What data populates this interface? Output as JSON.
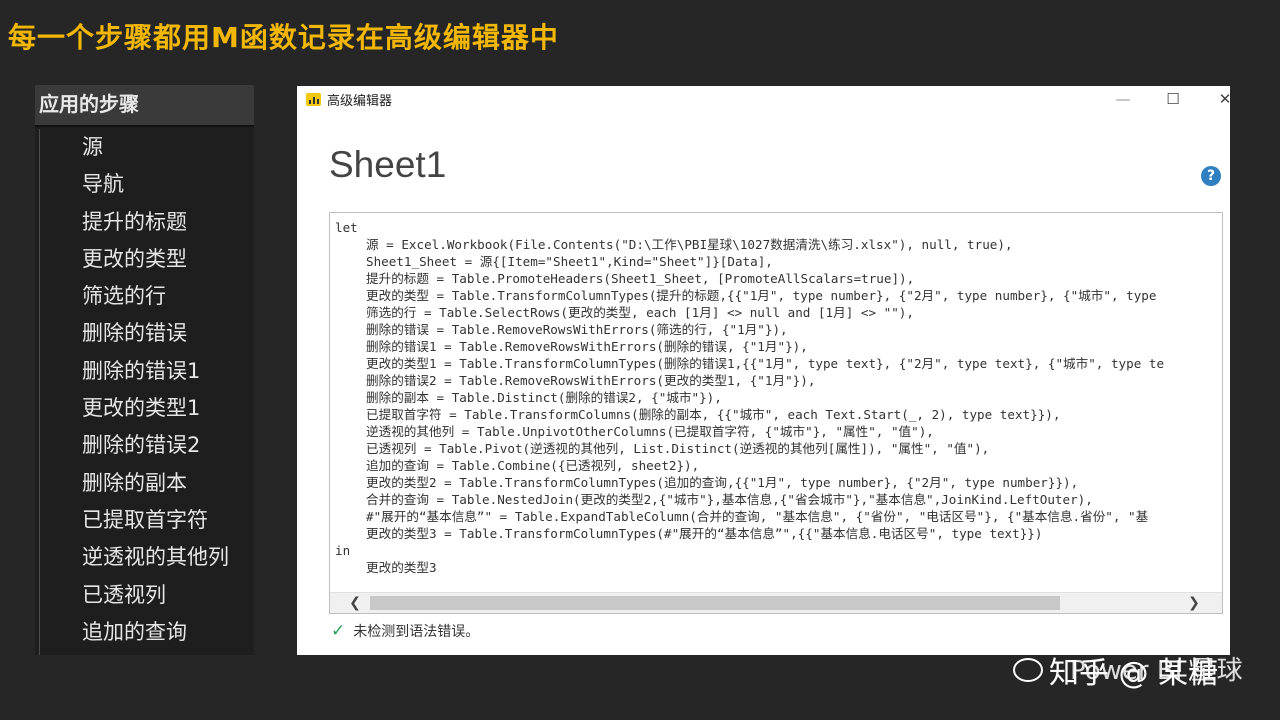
{
  "slide": {
    "title": "每一个步骤都用M函数记录在高级编辑器中"
  },
  "applied_steps": {
    "header": "应用的步骤",
    "items": [
      "源",
      "导航",
      "提升的标题",
      "更改的类型",
      "筛选的行",
      "删除的错误",
      "删除的错误1",
      "更改的类型1",
      "删除的错误2",
      "删除的副本",
      "已提取首字符",
      "逆透视的其他列",
      "已透视列",
      "追加的查询"
    ]
  },
  "editor": {
    "window_title": "高级编辑器",
    "query_name": "Sheet1",
    "help_glyph": "?",
    "window_controls": {
      "minimize": "—",
      "maximize": "☐",
      "close": "✕"
    },
    "code_lines": [
      "let",
      "源 = Excel.Workbook(File.Contents(\"D:\\工作\\PBI星球\\1027数据清洗\\练习.xlsx\"), null, true),",
      "Sheet1_Sheet = 源{[Item=\"Sheet1\",Kind=\"Sheet\"]}[Data],",
      "提升的标题 = Table.PromoteHeaders(Sheet1_Sheet, [PromoteAllScalars=true]),",
      "更改的类型 = Table.TransformColumnTypes(提升的标题,{{\"1月\", type number}, {\"2月\", type number}, {\"城市\", type",
      "筛选的行 = Table.SelectRows(更改的类型, each [1月] <> null and [1月] <> \"\"),",
      "删除的错误 = Table.RemoveRowsWithErrors(筛选的行, {\"1月\"}),",
      "删除的错误1 = Table.RemoveRowsWithErrors(删除的错误, {\"1月\"}),",
      "更改的类型1 = Table.TransformColumnTypes(删除的错误1,{{\"1月\", type text}, {\"2月\", type text}, {\"城市\", type te",
      "删除的错误2 = Table.RemoveRowsWithErrors(更改的类型1, {\"1月\"}),",
      "删除的副本 = Table.Distinct(删除的错误2, {\"城市\"}),",
      "已提取首字符 = Table.TransformColumns(删除的副本, {{\"城市\", each Text.Start(_, 2), type text}}),",
      "逆透视的其他列 = Table.UnpivotOtherColumns(已提取首字符, {\"城市\"}, \"属性\", \"值\"),",
      "已透视列 = Table.Pivot(逆透视的其他列, List.Distinct(逆透视的其他列[属性]), \"属性\", \"值\"),",
      "追加的查询 = Table.Combine({已透视列, sheet2}),",
      "更改的类型2 = Table.TransformColumnTypes(追加的查询,{{\"1月\", type number}, {\"2月\", type number}}),",
      "合并的查询 = Table.NestedJoin(更改的类型2,{\"城市\"},基本信息,{\"省会城市\"},\"基本信息\",JoinKind.LeftOuter),",
      "#\"展开的“基本信息”\" = Table.ExpandTableColumn(合并的查询, \"基本信息\", {\"省份\", \"电话区号\"}, {\"基本信息.省份\", \"基",
      "更改的类型3 = Table.TransformColumnTypes(#\"展开的“基本信息”\",{{\"基本信息.电话区号\", type text}})",
      "in",
      "更改的类型3"
    ],
    "scroll_left": "❮",
    "scroll_right": "❯",
    "status_icon": "✓",
    "status_text": "未检测到语法错误。"
  },
  "watermark": {
    "text": "知乎 @ 某糖",
    "overlay": "Power BI 星球"
  }
}
